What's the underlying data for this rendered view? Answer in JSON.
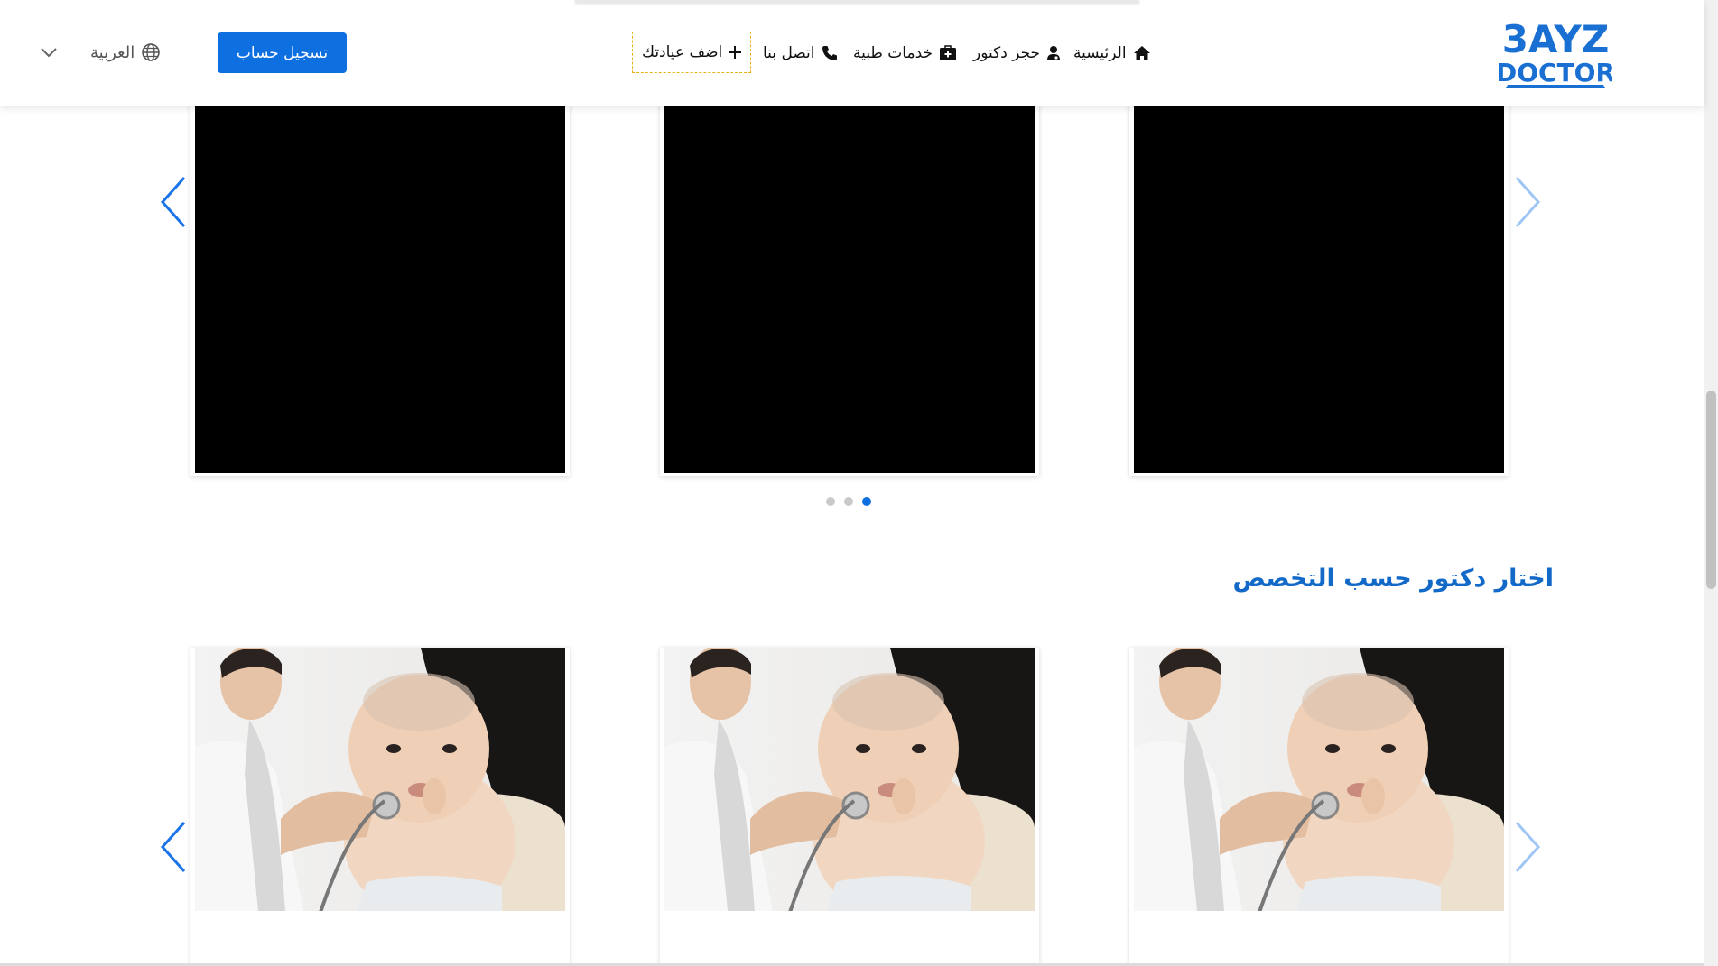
{
  "header": {
    "logo_text_top": "3AYZ",
    "logo_text_bottom": "DOCTOR",
    "nav": [
      {
        "label": "الرئيسية",
        "icon": "home-icon"
      },
      {
        "label": "حجز دكتور",
        "icon": "doctor-icon"
      },
      {
        "label": "خدمات طبية",
        "icon": "medical-kit-icon"
      },
      {
        "label": "اتصل بنا",
        "icon": "phone-icon"
      },
      {
        "label": "اضف عيادتك",
        "icon": "plus-icon"
      }
    ],
    "register_label": "تسجيل حساب",
    "language_label": "العربية",
    "language_icon": "globe-icon",
    "accent_color": "#0d6fe0"
  },
  "carousel_top": {
    "active_dot": 2,
    "dots": 3
  },
  "specialty_section": {
    "title": "اختار دكتور حسب التخصص",
    "title_color": "#1269c8",
    "card_image_alt": "Doctor examining a baby with a stethoscope"
  }
}
